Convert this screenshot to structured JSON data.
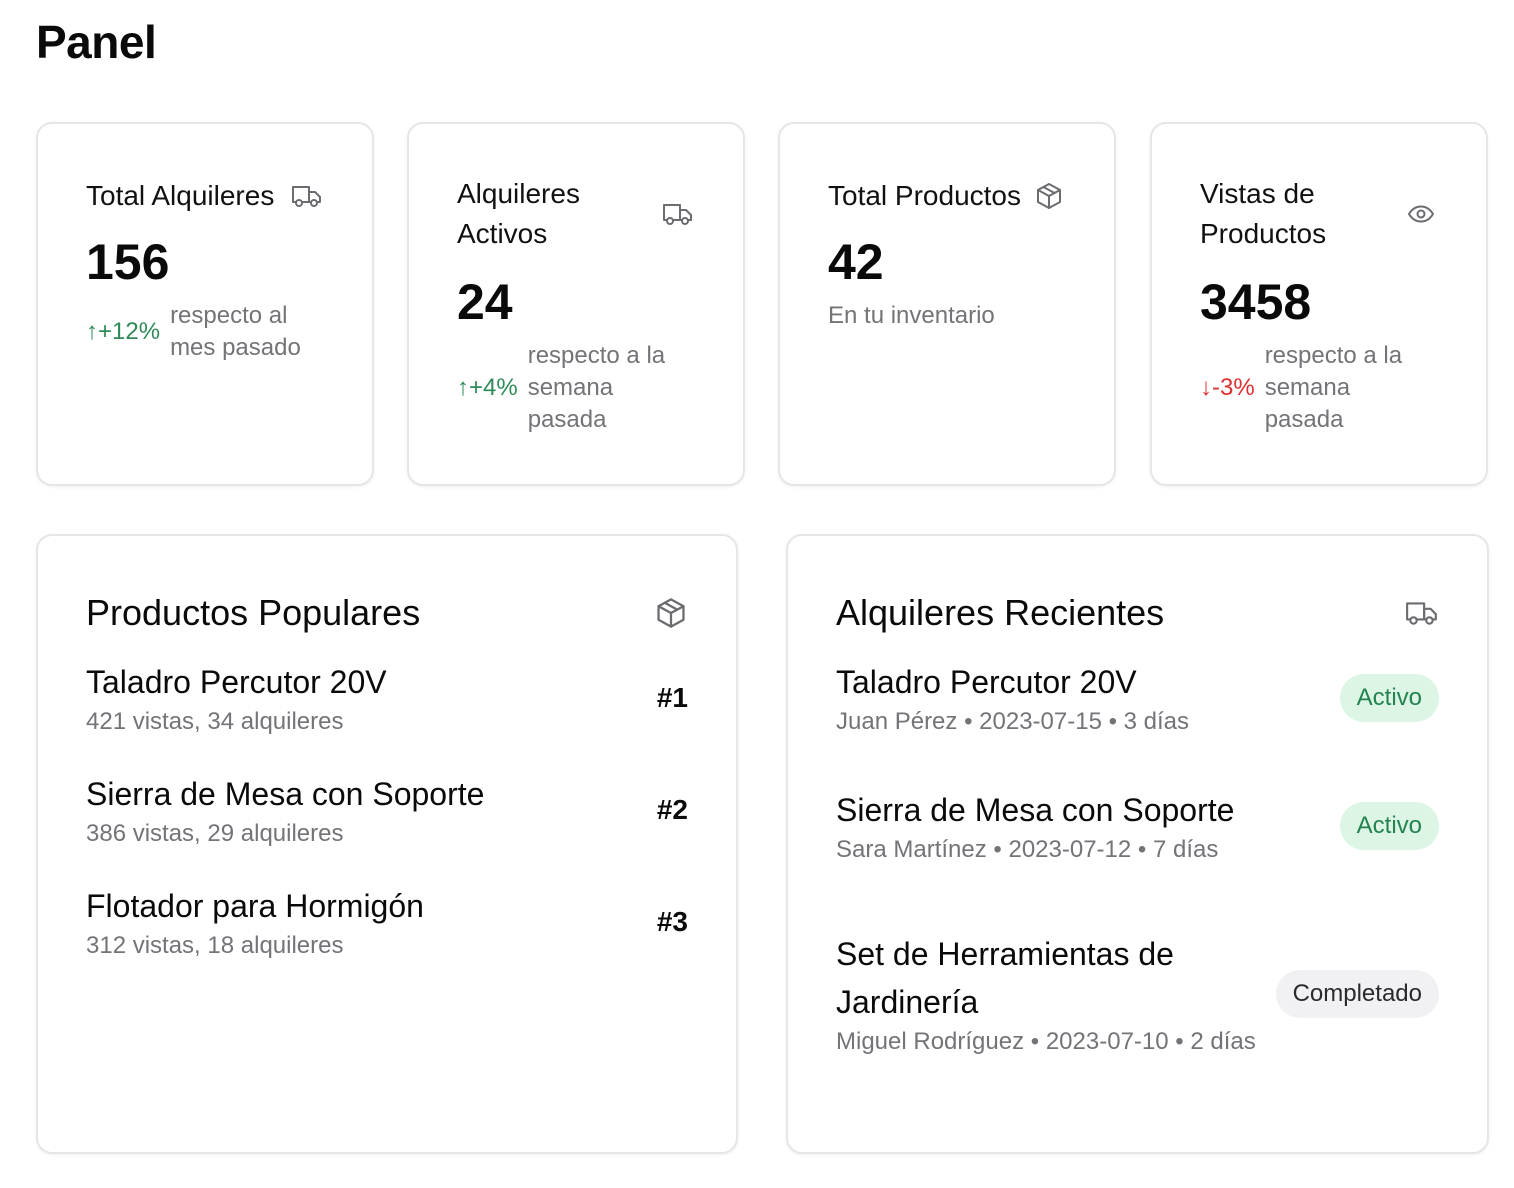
{
  "header": {
    "title": "Panel"
  },
  "stats": [
    {
      "label": "Total Alquileres",
      "icon": "truck-icon",
      "value": "156",
      "delta": "↑+12%",
      "delta_direction": "up",
      "note": "respecto al mes pasado"
    },
    {
      "label": "Alquileres Activos",
      "icon": "truck-icon",
      "value": "24",
      "delta": "↑+4%",
      "delta_direction": "up",
      "note": "respecto a la semana pasada"
    },
    {
      "label": "Total Productos",
      "icon": "package-icon",
      "value": "42",
      "delta": "",
      "note": "En tu inventario"
    },
    {
      "label": "Vistas de Productos",
      "icon": "eye-icon",
      "value": "3458",
      "delta": "↓-3%",
      "delta_direction": "down",
      "note": "respecto a la semana pasada"
    }
  ],
  "popular": {
    "title": "Productos Populares",
    "icon": "package-icon",
    "items": [
      {
        "name": "Taladro Percutor 20V",
        "stats": "421 vistas, 34 alquileres",
        "rank": "#1"
      },
      {
        "name": "Sierra de Mesa con Soporte",
        "stats": "386 vistas, 29 alquileres",
        "rank": "#2"
      },
      {
        "name": "Flotador para Hormigón",
        "stats": "312 vistas, 18 alquileres",
        "rank": "#3"
      }
    ]
  },
  "recent": {
    "title": "Alquileres Recientes",
    "icon": "truck-icon",
    "items": [
      {
        "name": "Taladro Percutor 20V",
        "details": "Juan Pérez • 2023-07-15 • 3 días",
        "status": "Activo"
      },
      {
        "name": "Sierra de Mesa con Soporte",
        "details": "Sara Martínez • 2023-07-12 • 7 días",
        "status": "Activo"
      },
      {
        "name": "Set de Herramientas de Jardinería",
        "details": "Miguel Rodríguez • 2023-07-10 • 2 días",
        "status": "Completado"
      }
    ]
  },
  "colors": {
    "up": "#2e8b57",
    "down": "#dc2f2f",
    "active_bg": "#dcf5e5",
    "active_text": "#23844f",
    "muted": "#737378"
  }
}
